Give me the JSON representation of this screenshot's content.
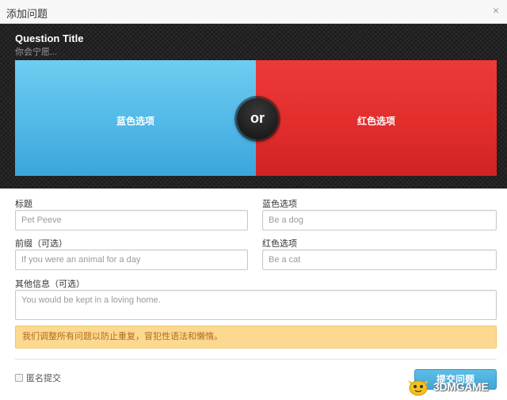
{
  "dialog": {
    "title": "添加问题",
    "close_glyph": "×"
  },
  "preview": {
    "title": "Question Title",
    "subtitle": "你会宁愿...",
    "blue_label": "蓝色选项",
    "red_label": "红色选项",
    "or_label": "or",
    "colors": {
      "blue": "#4fb6e6",
      "red": "#e22c2c",
      "background": "#232323"
    }
  },
  "form": {
    "title_label": "标题",
    "title_placeholder": "Pet Peeve",
    "prefix_label": "前缀（可选）",
    "prefix_placeholder": "If you were an animal for a day",
    "blue_label": "蓝色选项",
    "blue_placeholder": "Be a dog",
    "red_label": "红色选项",
    "red_placeholder": "Be a cat",
    "extra_label": "其他信息（可选）",
    "extra_placeholder": "You would be kept in a loving home.",
    "notice": "我们调整所有问题以防止重复，冒犯性语法和懒惰。",
    "anonymous_label": "匿名提交",
    "anonymous_checked": false,
    "submit_label": "提交问题"
  },
  "watermark": {
    "text": "3DMGAME",
    "icon": "mascot-icon"
  }
}
